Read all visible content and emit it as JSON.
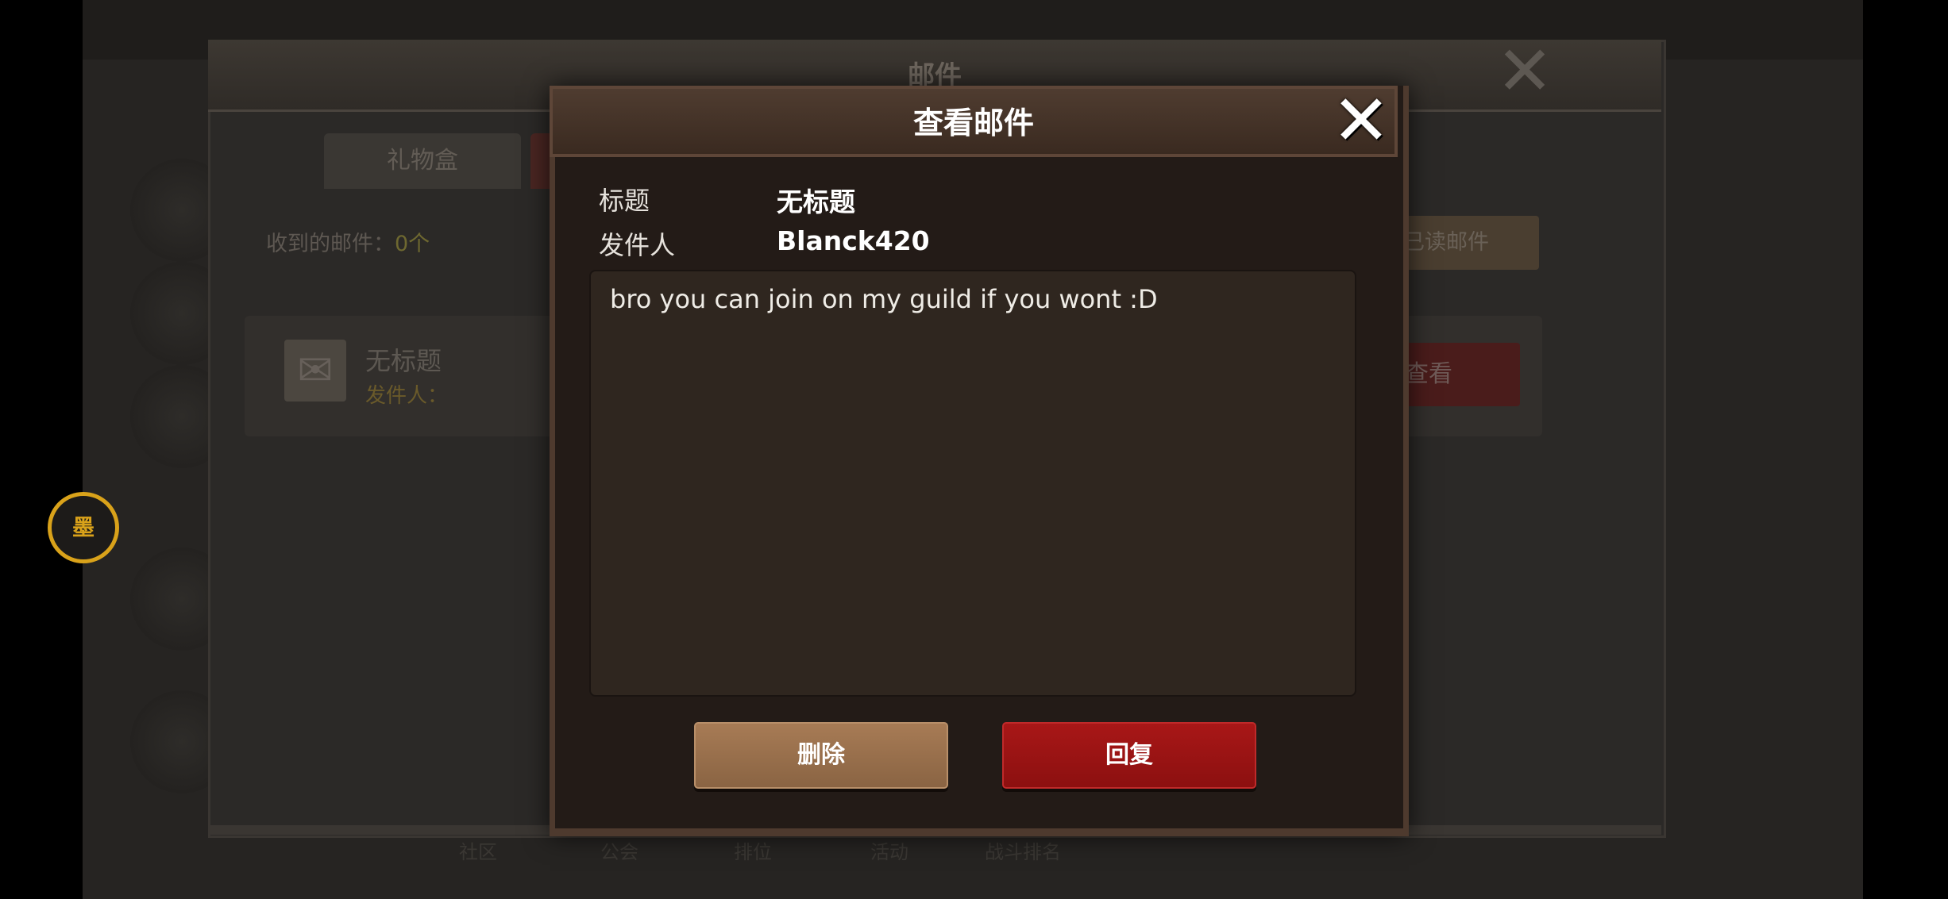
{
  "background": {
    "mail_window": {
      "title": "邮件",
      "tabs": [
        {
          "label": "礼物盒"
        },
        {
          "label": ""
        }
      ],
      "received_label": "收到的邮件：",
      "received_count": "0个",
      "delete_read_label": "删除已读邮件",
      "item": {
        "title": "无标题",
        "sender_label": "发件人：",
        "view_label": "查看"
      }
    },
    "avatar_badge": "墨",
    "bottom_tabs": [
      "社区",
      "公会",
      "排位",
      "活动",
      "战斗排名"
    ]
  },
  "dialog": {
    "title": "查看邮件",
    "subject_label": "标题",
    "subject_value": "无标题",
    "sender_label": "发件人",
    "sender_value": "Blanck420",
    "message": "bro you can join on my guild if you wont :D",
    "delete_label": "删除",
    "reply_label": "回复"
  },
  "icons": {
    "close": "close-icon",
    "envelope": "envelope-icon"
  },
  "colors": {
    "reply": "#a81717",
    "delete": "#a77b55",
    "dialog_bg": "#231b17"
  }
}
